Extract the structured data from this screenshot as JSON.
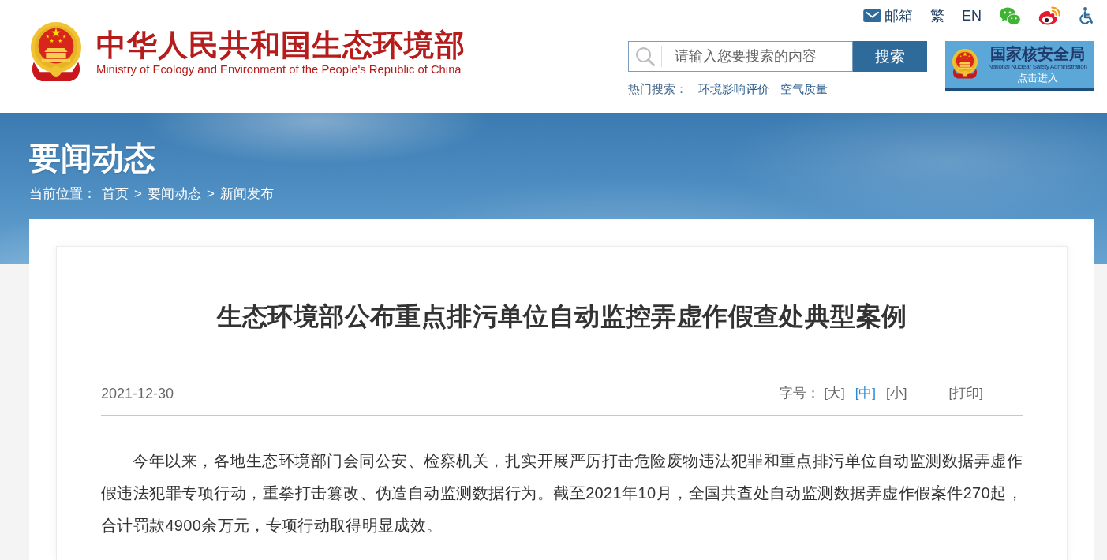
{
  "header": {
    "site_title": "中华人民共和国生态环境部",
    "site_subtitle": "Ministry of Ecology and Environment of the People's Republic of China",
    "top_links": [
      {
        "kind": "mail",
        "label": "邮箱"
      },
      {
        "kind": "text",
        "label": "繁"
      },
      {
        "kind": "text",
        "label": "EN"
      }
    ],
    "search": {
      "placeholder": "请输入您要搜索的内容",
      "button": "搜索"
    },
    "hot_search": {
      "label": "热门搜索：",
      "links": [
        "环境影响评价",
        "空气质量"
      ]
    },
    "nnsa_banner": {
      "title": "国家核安全局",
      "subtitle": "National Nuclear Safety Administration",
      "action": "点击进入"
    }
  },
  "banner": {
    "title": "要闻动态",
    "breadcrumb": {
      "label": "当前位置：",
      "items": [
        {
          "label": "首页"
        },
        {
          "separator": ">",
          "label": "要闻动态"
        },
        {
          "separator": ">",
          "label": "新闻发布"
        }
      ]
    }
  },
  "article": {
    "title": "生态环境部公布重点排污单位自动监控弄虚作假查处典型案例",
    "date": "2021-12-30",
    "font_size": {
      "label": "字号：",
      "options": [
        {
          "label": "[大]",
          "selected": false
        },
        {
          "label": "[中]",
          "selected": true
        },
        {
          "label": "[小]",
          "selected": false
        }
      ]
    },
    "print": "[打印]",
    "paragraphs": [
      "今年以来，各地生态环境部门会同公安、检察机关，扎实开展严厉打击危险废物违法犯罪和重点排污单位自动监测数据弄虚作假违法犯罪专项行动，重拳打击篡改、伪造自动监测数据行为。截至2021年10月，全国共查处自动监测数据弄虚作假案件270起，合计罚款4900余万元，专项行动取得明显成效。"
    ]
  }
}
